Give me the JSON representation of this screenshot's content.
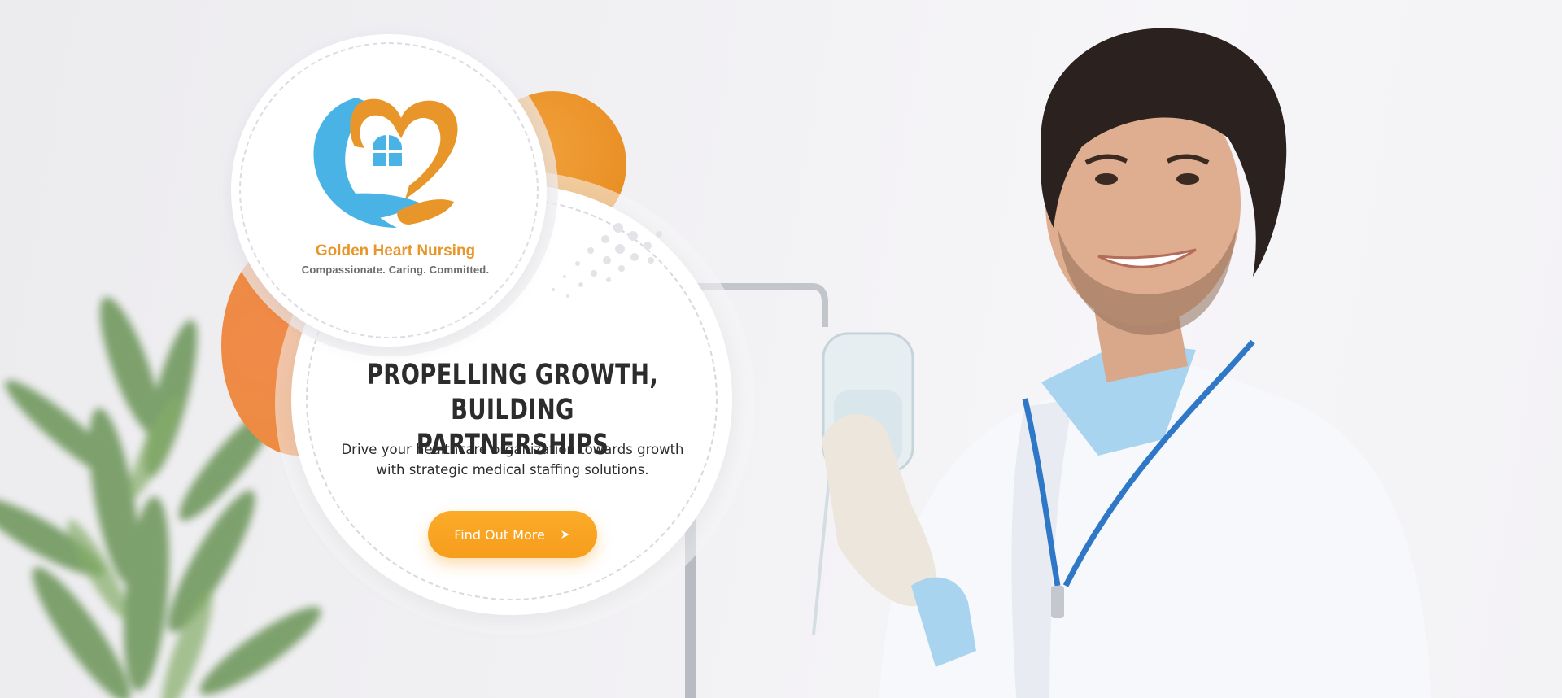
{
  "brand": {
    "name": "Golden Heart Nursing",
    "tagline": "Compassionate. Caring. Committed."
  },
  "hero": {
    "headline_line1": "PROPELLING GROWTH, BUILDING",
    "headline_line2": "PARTNERSHIPS",
    "subtext_line1": "Drive your healthcare organization towards growth",
    "subtext_line2": "with strategic medical staffing solutions.",
    "cta_label": "Find Out More"
  },
  "colors": {
    "accent_orange": "#f79d1c",
    "logo_orange": "#e8962a",
    "logo_blue": "#4ab3e6",
    "headline": "#2c2c2c"
  },
  "icons": {
    "logo": "heart-house-hands-logo-icon",
    "cta_arrow": "chevron-right-icon"
  }
}
